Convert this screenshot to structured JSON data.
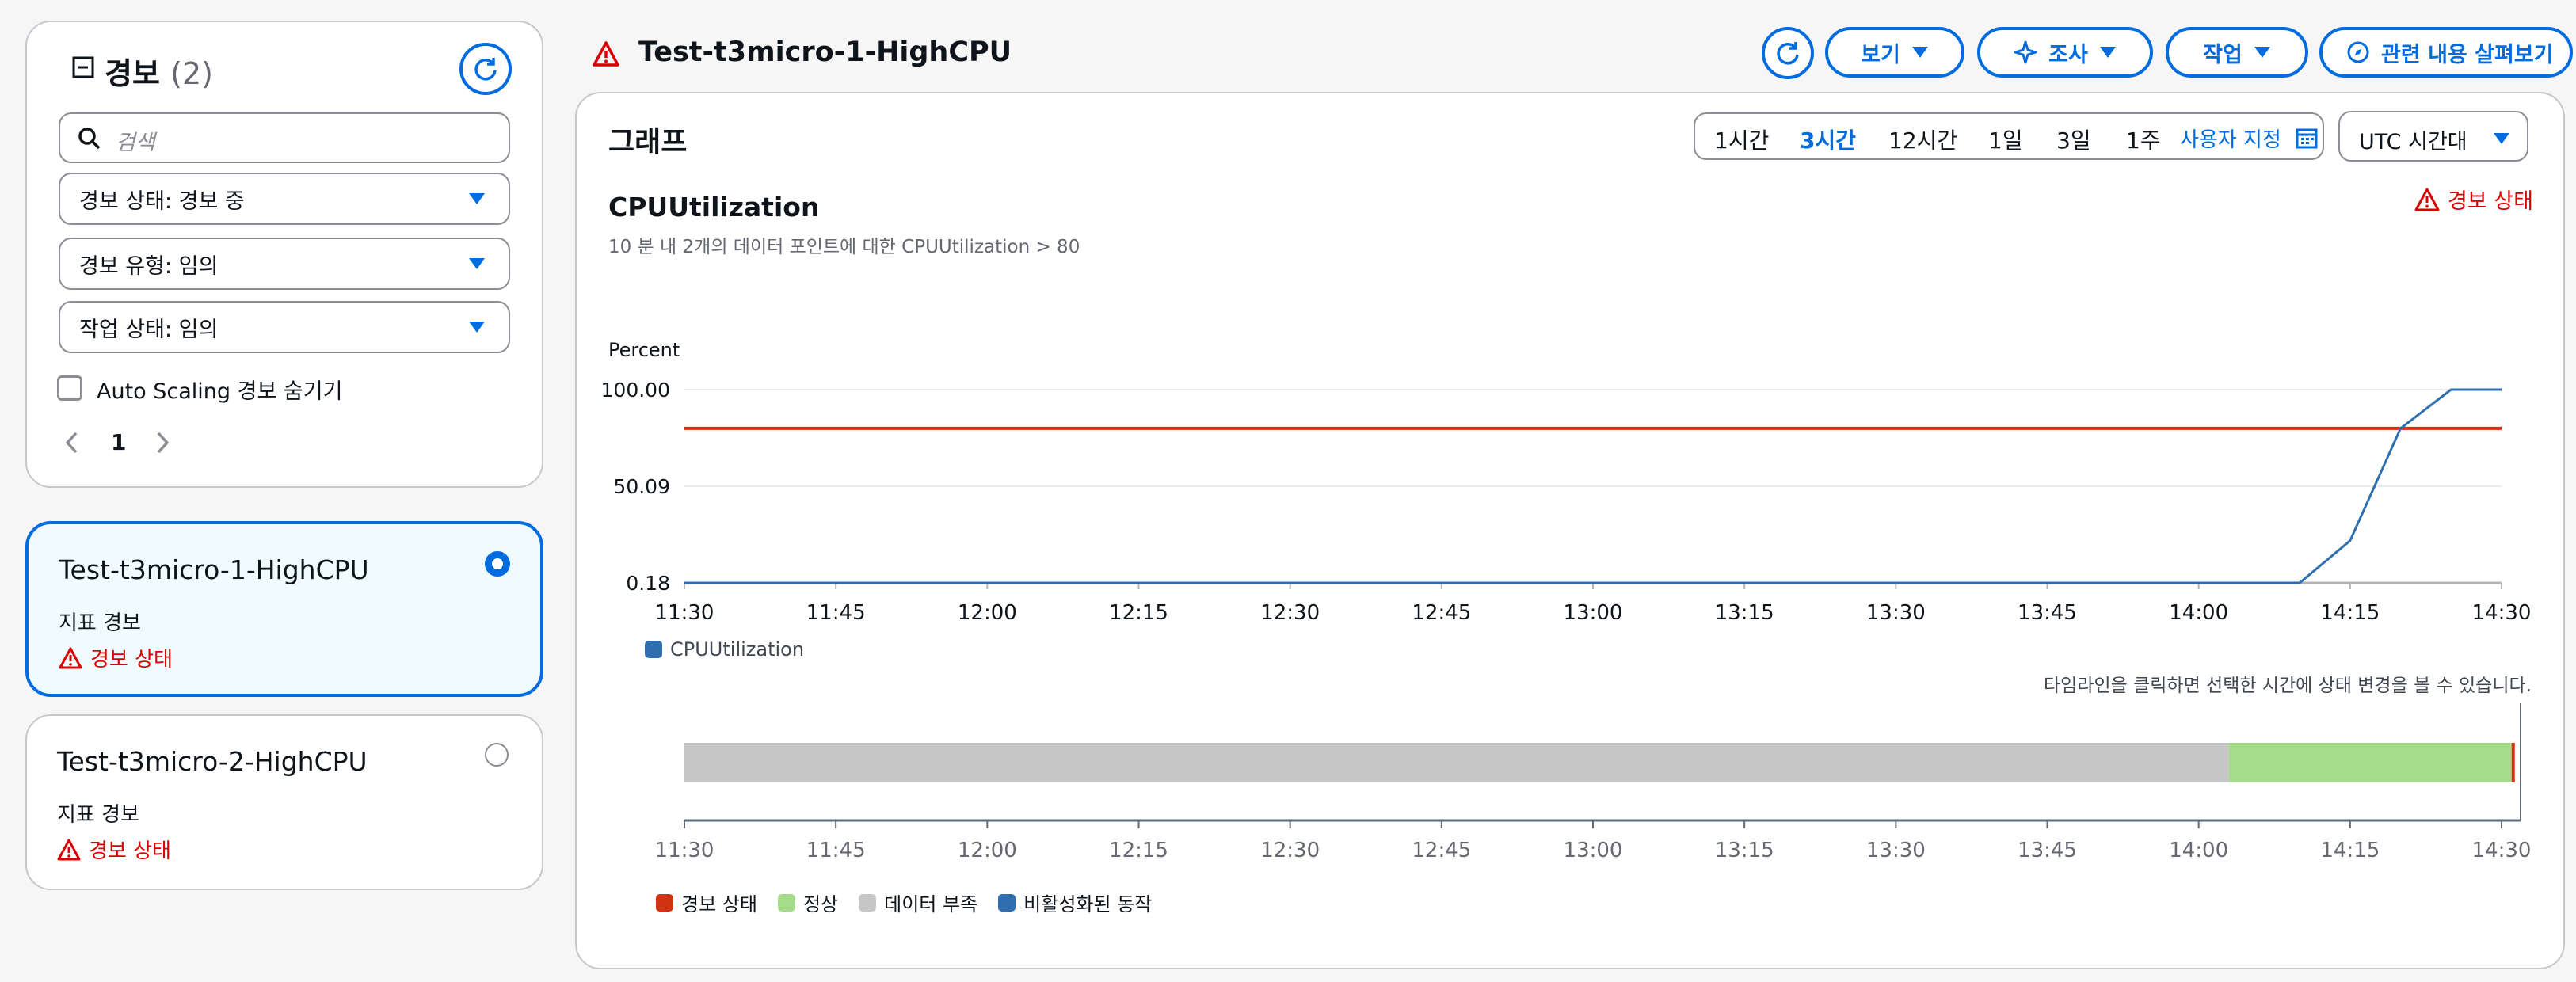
{
  "sidebar": {
    "title": "경보",
    "count": "(2)",
    "search_placeholder": "검색",
    "filters": [
      {
        "label": "경보 상태: 경보 중"
      },
      {
        "label": "경보 유형: 임의"
      },
      {
        "label": "작업 상태: 임의"
      }
    ],
    "hide_autoscaling_label": "Auto Scaling 경보 숨기기",
    "page": "1",
    "alarms": [
      {
        "name": "Test-t3micro-1-HighCPU",
        "type": "지표 경보",
        "state": "경보 상태",
        "selected": true
      },
      {
        "name": "Test-t3micro-2-HighCPU",
        "type": "지표 경보",
        "state": "경보 상태",
        "selected": false
      }
    ]
  },
  "header": {
    "title": "Test-t3micro-1-HighCPU",
    "view_label": "보기",
    "investigate_label": "조사",
    "actions_label": "작업",
    "explore_label": "관련 내용 살펴보기"
  },
  "graph": {
    "heading": "그래프",
    "ranges": [
      "1시간",
      "3시간",
      "12시간",
      "1일",
      "3일",
      "1주"
    ],
    "active_range": "3시간",
    "custom_label": "사용자 지정",
    "timezone_label": "UTC 시간대",
    "metric_title": "CPUUtilization",
    "metric_desc": "10 분 내 2개의 데이터 포인트에 대한 CPUUtilization > 80",
    "state_label": "경보 상태",
    "timeline_hint": "타임라인을 클릭하면 선택한 시간에 상태 변경을 볼 수 있습니다."
  },
  "chart_data": {
    "type": "line",
    "ylabel": "Percent",
    "y_ticks": [
      "100.00",
      "50.09",
      "0.18"
    ],
    "ylim": [
      0.18,
      100
    ],
    "x_ticks": [
      "11:30",
      "11:45",
      "12:00",
      "12:15",
      "12:30",
      "12:45",
      "13:00",
      "13:15",
      "13:30",
      "13:45",
      "14:00",
      "14:15",
      "14:30"
    ],
    "series": [
      {
        "name": "CPUUtilization",
        "color": "#2f6fb0",
        "x": [
          "11:30",
          "14:10",
          "14:15",
          "14:20",
          "14:25",
          "14:30"
        ],
        "y": [
          0.18,
          0.18,
          22,
          80,
          100,
          100
        ]
      }
    ],
    "threshold": {
      "value": 80,
      "color": "#d13212"
    },
    "legend": "bottom-left",
    "grid": true
  },
  "timeline": {
    "x_ticks": [
      "11:30",
      "11:45",
      "12:00",
      "12:15",
      "12:30",
      "12:45",
      "13:00",
      "13:15",
      "13:30",
      "13:45",
      "14:00",
      "14:15",
      "14:30"
    ],
    "segments": [
      {
        "state": "데이터 부족",
        "start": "11:30",
        "end": "14:03",
        "color": "#c6c6c6"
      },
      {
        "state": "정상",
        "start": "14:03",
        "end": "14:31",
        "color": "#a4dc8a"
      },
      {
        "state": "경보 상태",
        "start": "14:31",
        "end": "14:31",
        "color": "#d13212"
      }
    ],
    "legend": [
      {
        "label": "경보 상태",
        "color": "#d13212"
      },
      {
        "label": "정상",
        "color": "#a4dc8a"
      },
      {
        "label": "데이터 부족",
        "color": "#c6c6c6"
      },
      {
        "label": "비활성화된 동작",
        "color": "#2f6fb0"
      }
    ]
  },
  "colors": {
    "accent": "#006ce0",
    "alarm": "#db0000"
  }
}
